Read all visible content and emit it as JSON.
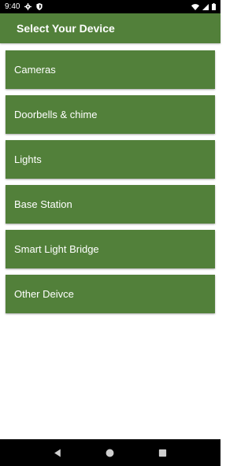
{
  "status_bar": {
    "time": "9:40",
    "icons": [
      "gear-icon",
      "shield-icon",
      "wifi-icon",
      "signal-icon",
      "battery-icon"
    ]
  },
  "app_bar": {
    "title": "Select Your Device"
  },
  "device_list": {
    "items": [
      {
        "label": "Cameras"
      },
      {
        "label": "Doorbells & chime"
      },
      {
        "label": "Lights"
      },
      {
        "label": "Base Station"
      },
      {
        "label": "Smart Light Bridge"
      },
      {
        "label": "Other Deivce"
      }
    ]
  },
  "nav_bar": {
    "buttons": [
      "back-icon",
      "home-icon",
      "recents-icon"
    ]
  },
  "colors": {
    "accent": "#52803a",
    "status_bar": "#000000",
    "nav_bar": "#000000",
    "background": "#ffffff"
  }
}
